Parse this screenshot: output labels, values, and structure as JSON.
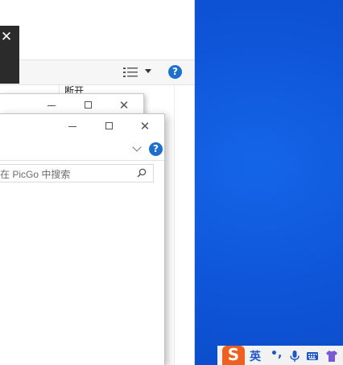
{
  "explorer": {
    "partial_text": "断开"
  },
  "popup": {
    "close_glyph": "✕"
  },
  "front_window": {
    "search_placeholder": "在 PicGo 中搜索",
    "help_glyph": "?"
  },
  "explorer_toolbar": {
    "help_glyph": "?"
  },
  "window_controls": {
    "close_glyph": "✕"
  },
  "tray": {
    "ime_logo": "S",
    "ime_language": "英",
    "ime_punctuation": "•,"
  },
  "colors": {
    "desktop_blue": "#0e55d8",
    "help_blue": "#1d6fcc",
    "ime_orange": "#ef5f1f",
    "tray_icon_blue": "#1c56c8"
  }
}
